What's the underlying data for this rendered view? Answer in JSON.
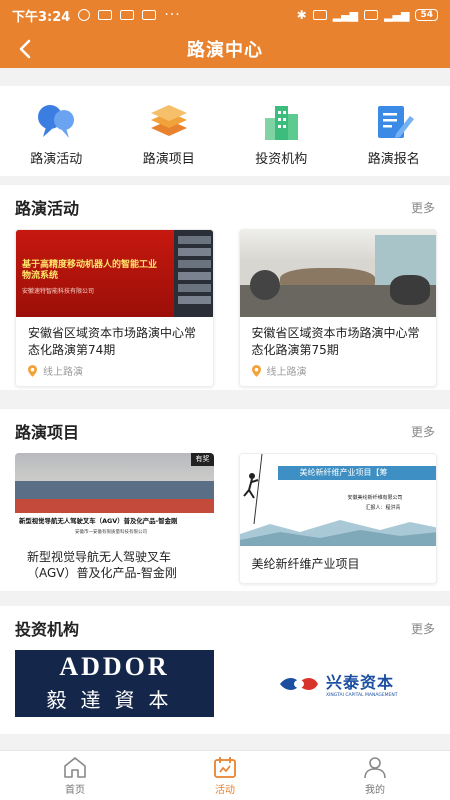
{
  "status": {
    "time": "下午3:24",
    "battery": "54"
  },
  "header": {
    "title": "路演中心"
  },
  "categories": [
    {
      "label": "路演活动",
      "icon": "chat-bubbles-icon"
    },
    {
      "label": "路演项目",
      "icon": "stack-icon"
    },
    {
      "label": "投资机构",
      "icon": "buildings-icon"
    },
    {
      "label": "路演报名",
      "icon": "form-pen-icon"
    }
  ],
  "activities": {
    "title": "路演活动",
    "more": "更多",
    "items": [
      {
        "title": "安徽省区域资本市场路演中心常态化路演第74期",
        "location": "线上路演",
        "slide_title": "基于高精度移动机器人的智能工业物流系统",
        "slide_company": "安徽速特智能科技有限公司"
      },
      {
        "title": "安徽省区域资本市场路演中心常态化路演第75期",
        "location": "线上路演"
      }
    ]
  },
  "projects": {
    "title": "路演项目",
    "more": "更多",
    "items": [
      {
        "title": "新型视觉导航无人驾驶叉车（AGV）普及化产品-智金刚",
        "banner_text": "新型视觉导航无人驾驶叉车（AGV）普及化产品-智金刚",
        "banner_sub": "安徽市一安徽有限质量科技有限公司",
        "badge": "有奖"
      },
      {
        "title": "美纶新纤维产业项目",
        "banner_text": "美纶新纤维产业项目【筹",
        "banner_company": "安徽美纶新纤维有限公司",
        "banner_reporter": "汇报人：程洪青"
      }
    ]
  },
  "investors": {
    "title": "投资机构",
    "more": "更多",
    "items": [
      {
        "name_en": "ADDOR",
        "name_cn": "毅達資本"
      },
      {
        "name_cn": "兴泰资本",
        "name_en": "XINGTAI CAPITAL MANAGEMENT"
      }
    ]
  },
  "tabs": [
    {
      "label": "首页",
      "icon": "home-icon",
      "active": false
    },
    {
      "label": "活动",
      "icon": "calendar-icon",
      "active": true
    },
    {
      "label": "我的",
      "icon": "user-icon",
      "active": false
    }
  ],
  "colors": {
    "brand": "#e8822e",
    "blue": "#3b7de0",
    "orange": "#f2a23a",
    "green": "#3dbd7d"
  }
}
